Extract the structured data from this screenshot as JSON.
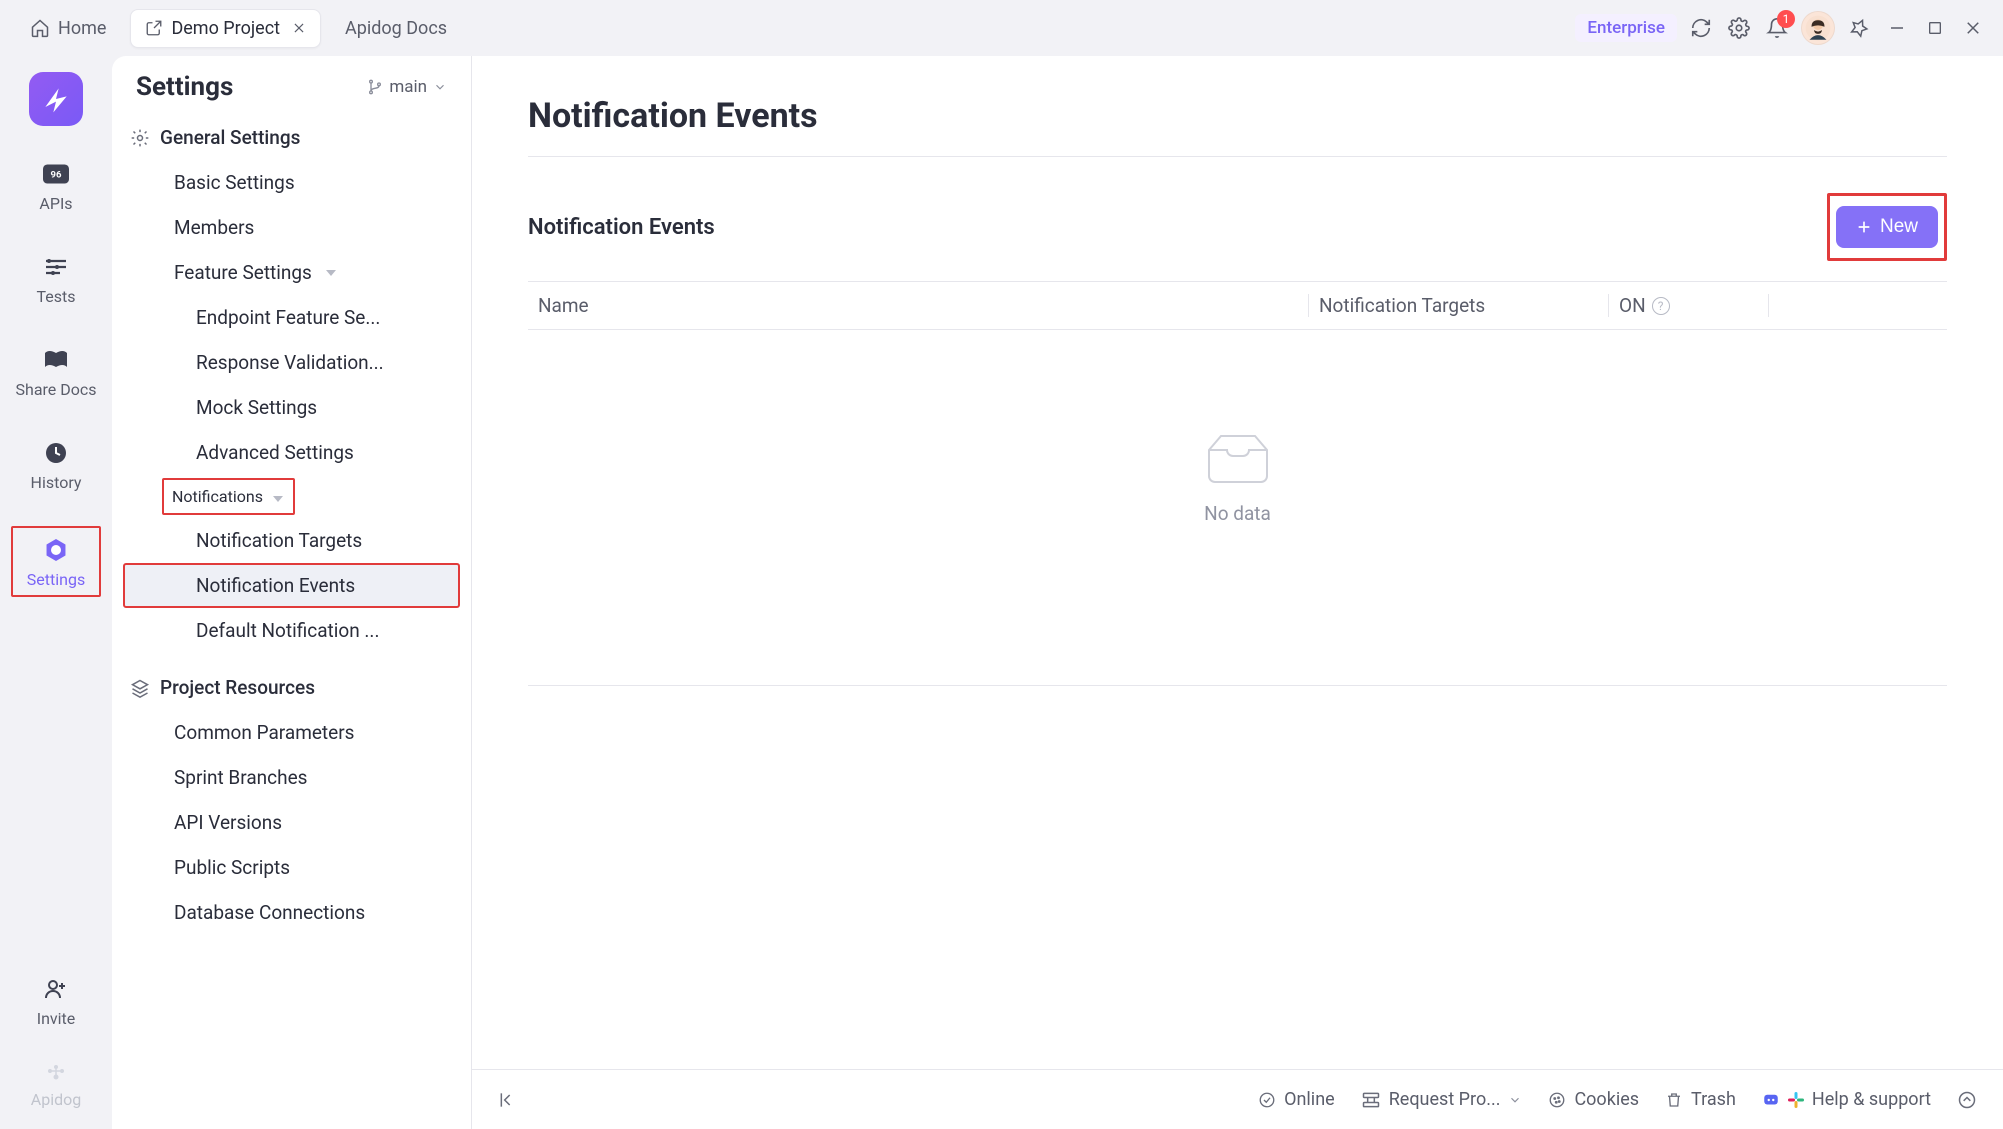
{
  "topbar": {
    "home_label": "Home",
    "project_tab": "Demo Project",
    "docs_tab": "Apidog Docs",
    "enterprise": "Enterprise",
    "badge_count": "1"
  },
  "rail": {
    "apis": "APIs",
    "tests": "Tests",
    "share_docs": "Share Docs",
    "history": "History",
    "settings": "Settings",
    "invite": "Invite",
    "brand": "Apidog"
  },
  "settings": {
    "title": "Settings",
    "branch": "main",
    "sections": {
      "general": "General Settings",
      "project_resources": "Project Resources"
    },
    "items": {
      "basic": "Basic Settings",
      "members": "Members",
      "feature": "Feature Settings",
      "endpoint_feature": "Endpoint Feature Se...",
      "response_validation": "Response Validation...",
      "mock": "Mock Settings",
      "advanced": "Advanced Settings",
      "notifications": "Notifications",
      "notification_targets": "Notification Targets",
      "notification_events": "Notification Events",
      "default_notification": "Default Notification ...",
      "common_parameters": "Common Parameters",
      "sprint_branches": "Sprint Branches",
      "api_versions": "API Versions",
      "public_scripts": "Public Scripts",
      "database_connections": "Database Connections"
    }
  },
  "page": {
    "title": "Notification Events",
    "section_title": "Notification Events",
    "new_button": "New",
    "cols": {
      "name": "Name",
      "targets": "Notification Targets",
      "on": "ON"
    },
    "empty": "No data"
  },
  "statusbar": {
    "online": "Online",
    "request_proxy": "Request Pro...",
    "cookies": "Cookies",
    "trash": "Trash",
    "help": "Help & support"
  }
}
